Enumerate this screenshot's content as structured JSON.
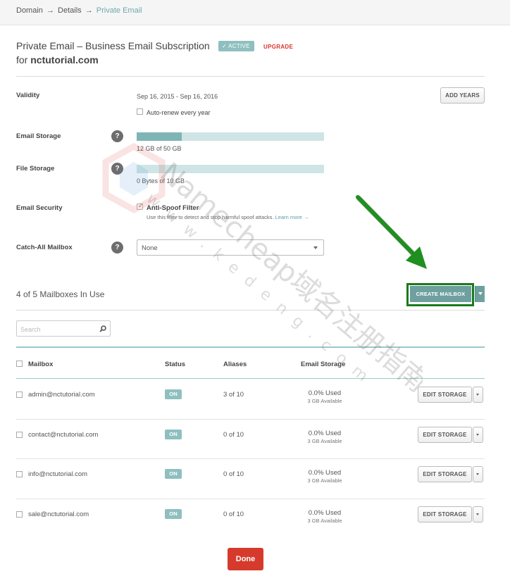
{
  "breadcrumb": {
    "items": [
      "Domain",
      "Details"
    ],
    "current": "Private Email",
    "separator": "→"
  },
  "header": {
    "title": "Private Email – Business Email Subscription",
    "status_badge": "ACTIVE",
    "upgrade_link": "UPGRADE",
    "for_prefix": "for",
    "domain": "nctutorial.com"
  },
  "validity": {
    "label": "Validity",
    "dates": "Sep 16, 2015 - Sep 16, 2016",
    "auto_renew_label": "Auto-renew every year",
    "auto_renew_checked": false,
    "add_years_label": "ADD YEARS"
  },
  "email_storage": {
    "label": "Email Storage",
    "help": "?",
    "usage_text": "12 GB of 50 GB",
    "fraction": 0.24
  },
  "file_storage": {
    "label": "File Storage",
    "help": "?",
    "usage_text": "0 Bytes of 10 GB",
    "fraction": 0
  },
  "email_security": {
    "label": "Email Security",
    "filter_label": "Anti-Spoof Filter",
    "filter_checked": true,
    "description": "Use this filter to detect and stop harmful spoof attacks.",
    "learn_more": "Learn more →"
  },
  "catch_all": {
    "label": "Catch-All Mailbox",
    "help": "?",
    "selected": "None"
  },
  "mailboxes": {
    "in_use_text": "4 of 5 Mailboxes In Use",
    "create_label": "CREATE MAILBOX",
    "search_placeholder": "Search",
    "columns": {
      "mailbox": "Mailbox",
      "status": "Status",
      "aliases": "Aliases",
      "storage": "Email Storage"
    },
    "rows": [
      {
        "email": "admin@nctutorial.com",
        "status": "ON",
        "aliases": "3 of 10",
        "used": "0.0% Used",
        "available": "3 GB Available",
        "edit_label": "EDIT STORAGE"
      },
      {
        "email": "contact@nctutorial.com",
        "status": "ON",
        "aliases": "0 of 10",
        "used": "0.0% Used",
        "available": "3 GB Available",
        "edit_label": "EDIT STORAGE"
      },
      {
        "email": "info@nctutorial.com",
        "status": "ON",
        "aliases": "0 of 10",
        "used": "0.0% Used",
        "available": "3 GB Available",
        "edit_label": "EDIT STORAGE"
      },
      {
        "email": "sale@nctutorial.com",
        "status": "ON",
        "aliases": "0 of 10",
        "used": "0.0% Used",
        "available": "3 GB Available",
        "edit_label": "EDIT STORAGE"
      }
    ]
  },
  "done_label": "Done",
  "watermark": {
    "line1": "Namecheap域名注册指南",
    "line2": "www.kedeng.com"
  },
  "colors": {
    "accent_teal": "#8fbfbf",
    "primary_red": "#d63a2c",
    "upgrade_red": "#d9342b",
    "annotation_green": "#1a7a1a"
  }
}
